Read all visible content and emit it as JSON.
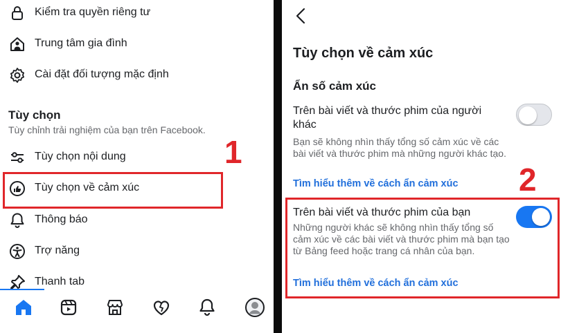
{
  "left_panel": {
    "menu_top": [
      {
        "label": "Kiểm tra quyền riêng tư",
        "icon": "lock-icon"
      },
      {
        "label": "Trung tâm gia đình",
        "icon": "family-icon"
      },
      {
        "label": "Cài đặt đối tượng mặc định",
        "icon": "gear-icon"
      }
    ],
    "section_title": "Tùy chọn",
    "section_subtitle": "Tùy chỉnh trải nghiệm của bạn trên Facebook.",
    "menu_bottom": [
      {
        "label": "Tùy chọn nội dung",
        "icon": "sliders-icon"
      },
      {
        "label": "Tùy chọn về cảm xúc",
        "icon": "reaction-icon"
      },
      {
        "label": "Thông báo",
        "icon": "bell-icon"
      },
      {
        "label": "Trợ năng",
        "icon": "accessibility-icon"
      },
      {
        "label": "Thanh tab",
        "icon": "pin-icon"
      }
    ],
    "step_number": "1",
    "tab_bar": [
      "home-icon",
      "video-icon",
      "marketplace-icon",
      "dating-icon",
      "notifications-icon",
      "profile-icon"
    ],
    "accent_color": "#1877f2"
  },
  "right_panel": {
    "title": "Tùy chọn về cảm xúc",
    "section": "Ẩn số cảm xúc",
    "option_1": {
      "title": "Trên bài viết và thước phim của người khác",
      "description": "Bạn sẽ không nhìn thấy tổng số cảm xúc về các bài viết và thước phim mà những người khác tạo.",
      "link": "Tìm hiểu thêm về cách ẩn cảm xúc",
      "enabled": false
    },
    "option_2": {
      "title": "Trên bài viết và thước phim của bạn",
      "description": "Những người khác sẽ không nhìn thấy tổng số cảm xúc về các bài viết và thước phim mà bạn tạo từ Bảng feed hoặc trang cá nhân của bạn.",
      "link": "Tìm hiểu thêm về cách ẩn cảm xúc",
      "enabled": true
    },
    "step_number": "2",
    "highlight_color": "#e0262a"
  }
}
